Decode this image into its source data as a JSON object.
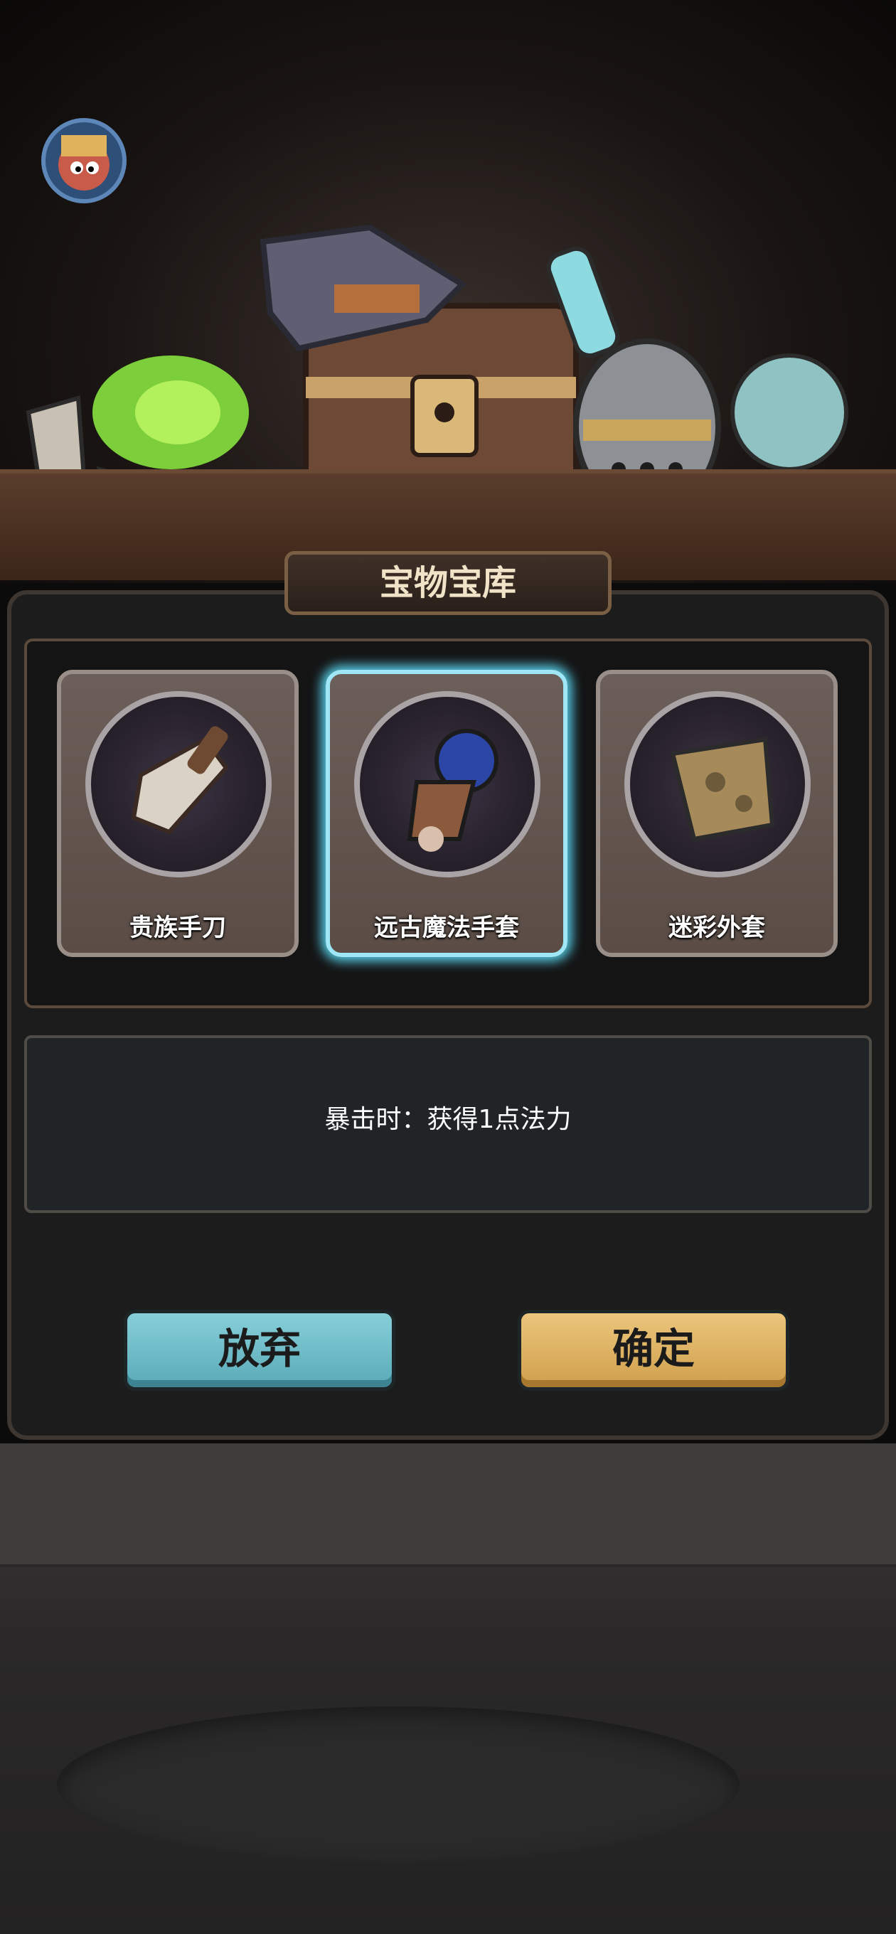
{
  "screen": {
    "title": "宝物宝库",
    "items": [
      {
        "name": "贵族手刀",
        "icon": "cleaver-icon",
        "selected": false
      },
      {
        "name": "远古魔法手套",
        "icon": "gauntlet-icon",
        "selected": true
      },
      {
        "name": "迷彩外套",
        "icon": "coat-icon",
        "selected": false
      }
    ],
    "description": "暴击时：获得1点法力",
    "buttons": {
      "abandon": "放弃",
      "confirm": "确定"
    }
  },
  "avatar": {
    "icon": "hero-portrait-icon"
  },
  "colors": {
    "selection_glow": "#58d2ee",
    "abandon_button": "#6bbcc8",
    "confirm_button": "#e0b566",
    "panel": "#1c1c1d"
  }
}
